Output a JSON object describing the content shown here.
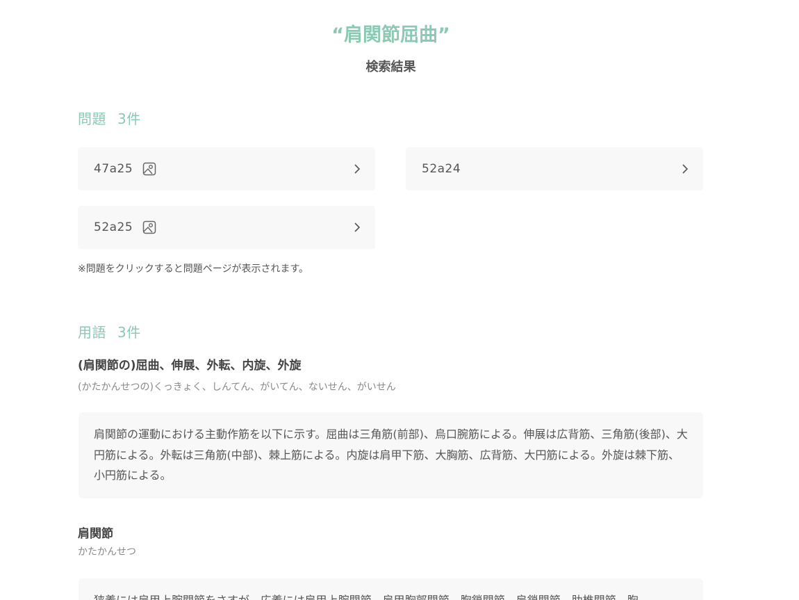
{
  "header": {
    "query": "“肩関節屈曲”",
    "subtitle": "検索結果"
  },
  "questions": {
    "label": "問題",
    "count": "3件",
    "items": [
      {
        "label": "47a25",
        "has_image": true,
        "icon": "image-icon"
      },
      {
        "label": "52a24",
        "has_image": false
      },
      {
        "label": "52a25",
        "has_image": true,
        "icon": "image-icon"
      }
    ],
    "note": "※問題をクリックすると問題ページが表示されます。"
  },
  "terms": {
    "label": "用語",
    "count": "3件",
    "items": [
      {
        "title": "(肩関節の)屈曲、伸展、外転、内旋、外旋",
        "reading": "(かたかんせつの)くっきょく、しんてん、がいてん、ないせん、がいせん",
        "body": "肩関節の運動における主動作筋を以下に示す。屈曲は三角筋(前部)、烏口腕筋による。伸展は広背筋、三角筋(後部)、大円筋による。外転は三角筋(中部)、棘上筋による。内旋は肩甲下筋、大胸筋、広背筋、大円筋による。外旋は棘下筋、小円筋による。"
      },
      {
        "title": "肩関節",
        "reading": "かたかんせつ",
        "body": "狭義には肩甲上腕関節をさすが、広義には肩甲上腕関節、肩甲胸郭関節、胸鎖関節、肩鎖関節、肋椎関節、胸"
      }
    ]
  },
  "colors": {
    "accent": "#8cc9b3",
    "card_bg": "#f8f8f8"
  }
}
